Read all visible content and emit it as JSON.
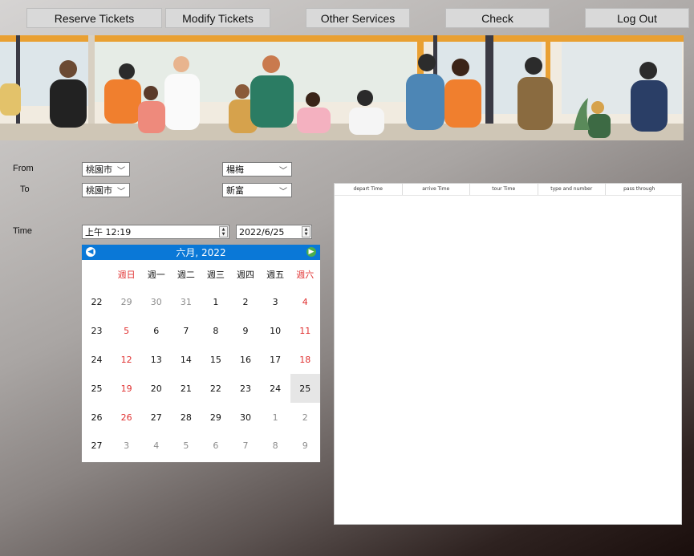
{
  "nav": {
    "reserve": "Reserve Tickets",
    "modify": "Modify Tickets",
    "other": "Other Services",
    "check": "Check",
    "logout": "Log Out"
  },
  "form": {
    "from_label": "From",
    "to_label": "To",
    "time_label": "Time",
    "from_city": "桃園市",
    "from_station": "楊梅",
    "to_city": "桃園市",
    "to_station": "新富",
    "time_value": "上午 12:19",
    "date_value": "2022/6/25"
  },
  "calendar": {
    "header": "六月, 2022",
    "weekdays": [
      "週日",
      "週一",
      "週二",
      "週三",
      "週四",
      "週五",
      "週六"
    ],
    "rows": [
      {
        "week": "22",
        "days": [
          "29",
          "30",
          "31",
          "1",
          "2",
          "3",
          "4"
        ]
      },
      {
        "week": "23",
        "days": [
          "5",
          "6",
          "7",
          "8",
          "9",
          "10",
          "11"
        ]
      },
      {
        "week": "24",
        "days": [
          "12",
          "13",
          "14",
          "15",
          "16",
          "17",
          "18"
        ]
      },
      {
        "week": "25",
        "days": [
          "19",
          "20",
          "21",
          "22",
          "23",
          "24",
          "25"
        ]
      },
      {
        "week": "26",
        "days": [
          "26",
          "27",
          "28",
          "29",
          "30",
          "1",
          "2"
        ]
      },
      {
        "week": "27",
        "days": [
          "3",
          "4",
          "5",
          "6",
          "7",
          "8",
          "9"
        ]
      }
    ],
    "accent": "#0a78d7",
    "weekend_color": "#e03030"
  },
  "results": {
    "columns": [
      "depart Time",
      "arrive Time",
      "tour Time",
      "type and number",
      "pass through"
    ]
  }
}
